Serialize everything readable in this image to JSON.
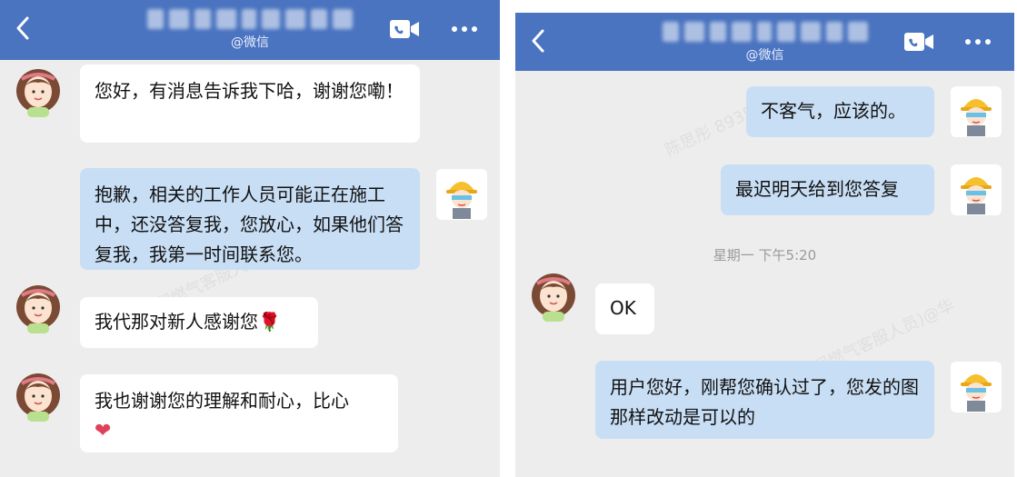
{
  "left": {
    "header": {
      "subtitle": "@微信"
    },
    "messages": [
      {
        "side": "in",
        "text": "您好，有消息告诉我下哈，谢谢您嘞！"
      },
      {
        "side": "out",
        "text": "抱歉，相关的工作人员可能正在施工中，还没答复我，您放心，如果他们答复我，我第一时间联系您。"
      },
      {
        "side": "in",
        "text": "我代那对新人感谢您",
        "emoji": "🌹"
      },
      {
        "side": "in",
        "text": "我也谢谢您的理解和耐心，比心",
        "emoji": "❤"
      }
    ]
  },
  "right": {
    "header": {
      "subtitle": "@微信"
    },
    "messages": [
      {
        "side": "out",
        "text": "不客气，应该的。"
      },
      {
        "side": "out",
        "text": "最迟明天给到您答复"
      },
      {
        "side": "in",
        "text": "OK"
      },
      {
        "side": "out",
        "text": "用户您好，刚帮您确认过了，您发的图那样改动是可以的"
      }
    ],
    "timestamp": "星期一 下午5:20"
  },
  "watermark": "陈思彤(华润燃气客服人员)@华润燃气 8935",
  "colors": {
    "header": "#4a74c0",
    "background": "#ededed",
    "bubble_in": "#ffffff",
    "bubble_out": "#c8def5"
  },
  "icons": [
    "back-arrow-icon",
    "video-call-icon",
    "more-icon",
    "woman-avatar-icon",
    "worker-avatar-icon"
  ]
}
